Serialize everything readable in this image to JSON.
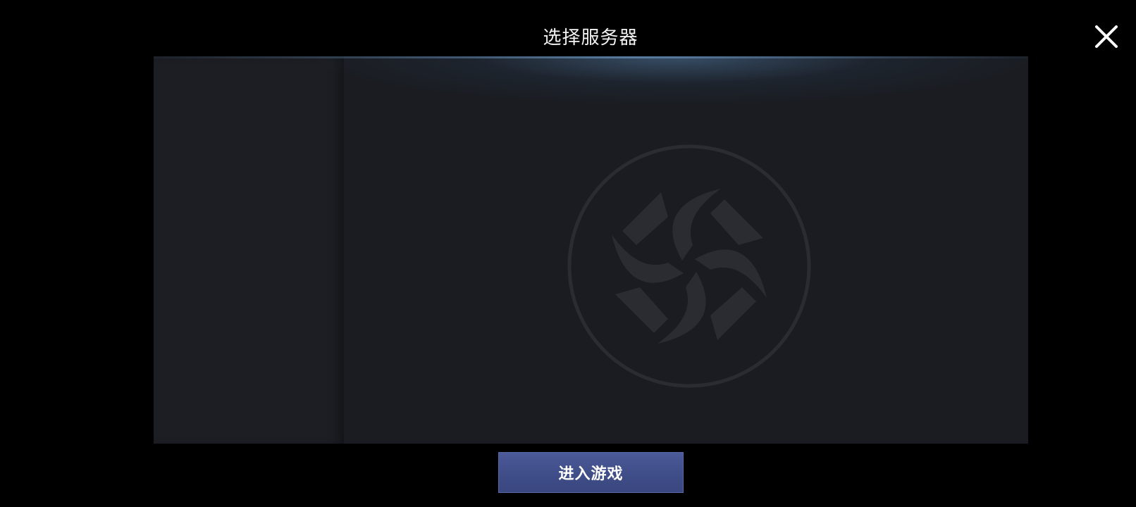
{
  "dialog": {
    "title": "选择服务器"
  },
  "actions": {
    "enter_label": "进入游戏"
  },
  "icons": {
    "close": "close-icon",
    "emblem": "game-logo-emblem-icon"
  },
  "colors": {
    "background": "#000000",
    "panel": "#1b1d22",
    "button": "#4a5796",
    "emblem": "#2a2c31",
    "title_text": "#f2f2f2"
  }
}
